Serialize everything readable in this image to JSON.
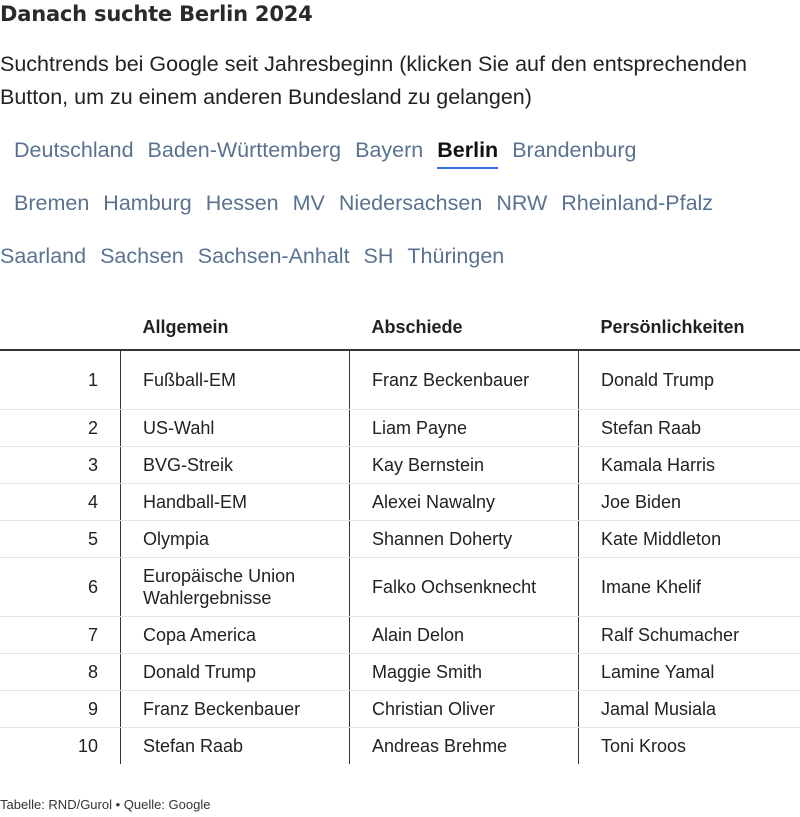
{
  "title": "Danach suchte Berlin 2024",
  "subtitle": "Suchtrends bei Google seit Jahresbeginn (klicken Sie auf den entsprechenden Button, um zu einem anderen Bundesland zu gelangen)",
  "tabs": [
    {
      "label": "Deutschland",
      "active": false
    },
    {
      "label": "Baden-Württemberg",
      "active": false
    },
    {
      "label": "Bayern",
      "active": false
    },
    {
      "label": "Berlin",
      "active": true
    },
    {
      "label": "Brandenburg",
      "active": false
    },
    {
      "label": "Bremen",
      "active": false
    },
    {
      "label": "Hamburg",
      "active": false
    },
    {
      "label": "Hessen",
      "active": false
    },
    {
      "label": "MV",
      "active": false
    },
    {
      "label": "Niedersachsen",
      "active": false
    },
    {
      "label": "NRW",
      "active": false
    },
    {
      "label": "Rheinland-Pfalz",
      "active": false
    },
    {
      "label": "Saarland",
      "active": false
    },
    {
      "label": "Sachsen",
      "active": false
    },
    {
      "label": "Sachsen-Anhalt",
      "active": false
    },
    {
      "label": "SH",
      "active": false
    },
    {
      "label": "Thüringen",
      "active": false
    }
  ],
  "accent_color": "#3a6ee8",
  "table": {
    "headers": [
      "",
      "Allgemein",
      "Abschiede",
      "Persönlichkeiten"
    ],
    "rows": [
      [
        "1",
        "Fußball-EM",
        "Franz Beckenbauer",
        "Donald Trump"
      ],
      [
        "2",
        "US-Wahl",
        "Liam Payne",
        "Stefan Raab"
      ],
      [
        "3",
        "BVG-Streik",
        "Kay Bernstein",
        "Kamala Harris"
      ],
      [
        "4",
        "Handball-EM",
        "Alexei Nawalny",
        "Joe Biden"
      ],
      [
        "5",
        "Olympia",
        "Shannen Doherty",
        "Kate Middleton"
      ],
      [
        "6",
        "Europäische Union Wahlergebnisse",
        "Falko Ochsenknecht",
        "Imane Khelif"
      ],
      [
        "7",
        "Copa America",
        "Alain Delon",
        "Ralf Schumacher"
      ],
      [
        "8",
        "Donald Trump",
        "Maggie Smith",
        "Lamine Yamal"
      ],
      [
        "9",
        "Franz Beckenbauer",
        "Christian Oliver",
        "Jamal Musiala"
      ],
      [
        "10",
        "Stefan Raab",
        "Andreas Brehme",
        "Toni Kroos"
      ]
    ]
  },
  "footer": "Tabelle: RND/Gurol • Quelle: Google"
}
